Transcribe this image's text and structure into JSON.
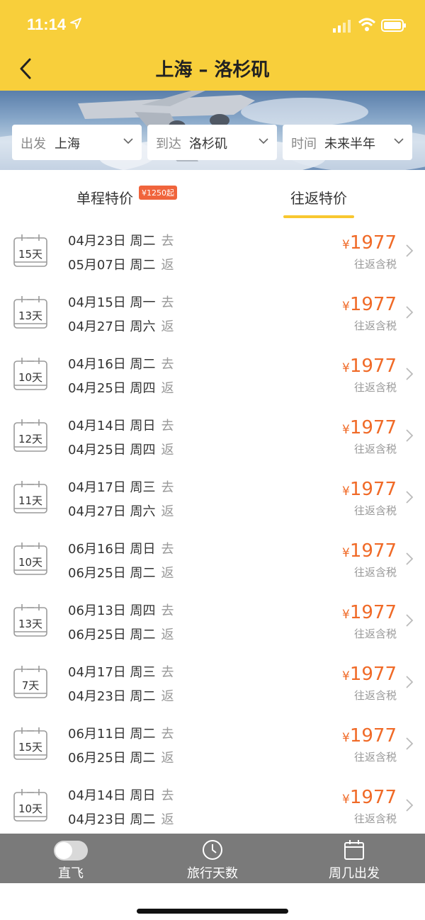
{
  "status_bar": {
    "time": "11:14"
  },
  "nav": {
    "title": "上海 – 洛杉矶"
  },
  "filters": [
    {
      "key": "出发",
      "value": "上海"
    },
    {
      "key": "到达",
      "value": "洛杉矶"
    },
    {
      "key": "时间",
      "value": "未来半年"
    }
  ],
  "tabs": {
    "oneway": {
      "label": "单程特价",
      "badge": "¥1250起"
    },
    "roundtrip": {
      "label": "往返特价"
    }
  },
  "list": [
    {
      "days": "15天",
      "go": "04月23日 周二",
      "ret": "05月07日 周二",
      "price": "1977"
    },
    {
      "days": "13天",
      "go": "04月15日 周一",
      "ret": "04月27日 周六",
      "price": "1977"
    },
    {
      "days": "10天",
      "go": "04月16日 周二",
      "ret": "04月25日 周四",
      "price": "1977"
    },
    {
      "days": "12天",
      "go": "04月14日 周日",
      "ret": "04月25日 周四",
      "price": "1977"
    },
    {
      "days": "11天",
      "go": "04月17日 周三",
      "ret": "04月27日 周六",
      "price": "1977"
    },
    {
      "days": "10天",
      "go": "06月16日 周日",
      "ret": "06月25日 周二",
      "price": "1977"
    },
    {
      "days": "13天",
      "go": "06月13日 周四",
      "ret": "06月25日 周二",
      "price": "1977"
    },
    {
      "days": "7天",
      "go": "04月17日 周三",
      "ret": "04月23日 周二",
      "price": "1977"
    },
    {
      "days": "15天",
      "go": "06月11日 周二",
      "ret": "06月25日 周二",
      "price": "1977"
    },
    {
      "days": "10天",
      "go": "04月14日 周日",
      "ret": "04月23日 周二",
      "price": "1977"
    }
  ],
  "row_labels": {
    "go": "去",
    "ret": "返",
    "yen": "¥",
    "note": "往返含税"
  },
  "bottom_bar": {
    "direct": "直飞",
    "days": "旅行天数",
    "weekday": "周几出发"
  },
  "colors": {
    "brand_yellow": "#f8cf3b",
    "price_orange": "#f06a27",
    "badge_red": "#f0643c"
  },
  "icons": [
    "back-arrow-icon",
    "location-arrow-icon",
    "signal-icon",
    "wifi-icon",
    "battery-icon",
    "chevron-down-icon",
    "calendar-icon",
    "chevron-right-icon",
    "toggle-switch",
    "clock-icon",
    "calendar-week-icon"
  ]
}
